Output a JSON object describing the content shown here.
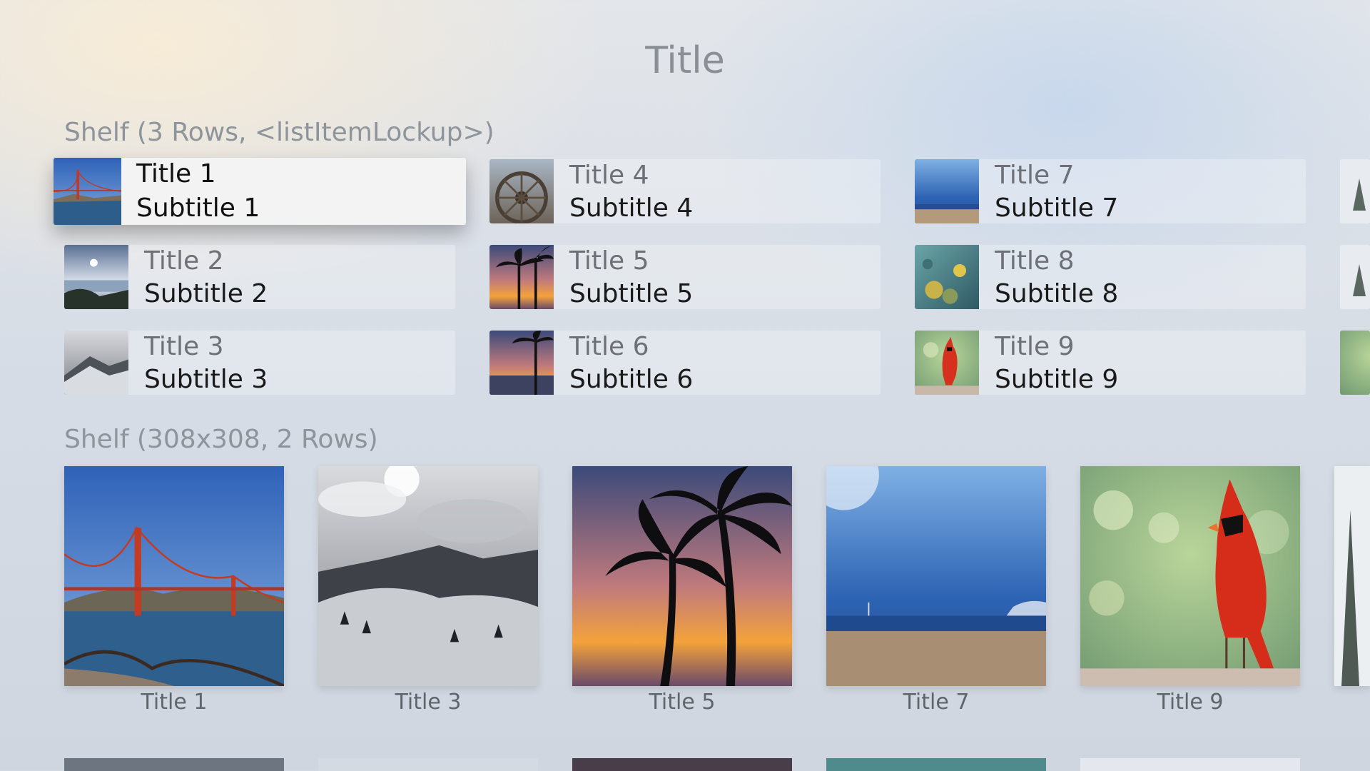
{
  "page": {
    "title": "Title"
  },
  "shelf_list": {
    "header": "Shelf (3 Rows, <listItemLockup>)",
    "items": [
      {
        "title": "Title 1",
        "subtitle": "Subtitle 1",
        "thumb": "golden-gate",
        "focused": true
      },
      {
        "title": "Title 2",
        "subtitle": "Subtitle 2",
        "thumb": "sunset-coast"
      },
      {
        "title": "Title 3",
        "subtitle": "Subtitle 3",
        "thumb": "snowy-mountain"
      },
      {
        "title": "Title 4",
        "subtitle": "Subtitle 4",
        "thumb": "water-wheel"
      },
      {
        "title": "Title 5",
        "subtitle": "Subtitle 5",
        "thumb": "palm-sunset"
      },
      {
        "title": "Title 6",
        "subtitle": "Subtitle 6",
        "thumb": "palm-beach"
      },
      {
        "title": "Title 7",
        "subtitle": "Subtitle 7",
        "thumb": "beach-sky"
      },
      {
        "title": "Title 8",
        "subtitle": "Subtitle 8",
        "thumb": "reef-fish"
      },
      {
        "title": "Title 9",
        "subtitle": "Subtitle 9",
        "thumb": "cardinal"
      }
    ]
  },
  "shelf_grid": {
    "header": "Shelf (308x308, 2 Rows)",
    "items": [
      {
        "label": "Title 1",
        "image": "golden-gate"
      },
      {
        "label": "Title 3",
        "image": "snowy-mountain"
      },
      {
        "label": "Title 5",
        "image": "palm-sunset"
      },
      {
        "label": "Title 7",
        "image": "beach-sky"
      },
      {
        "label": "Title 9",
        "image": "cardinal"
      }
    ]
  }
}
